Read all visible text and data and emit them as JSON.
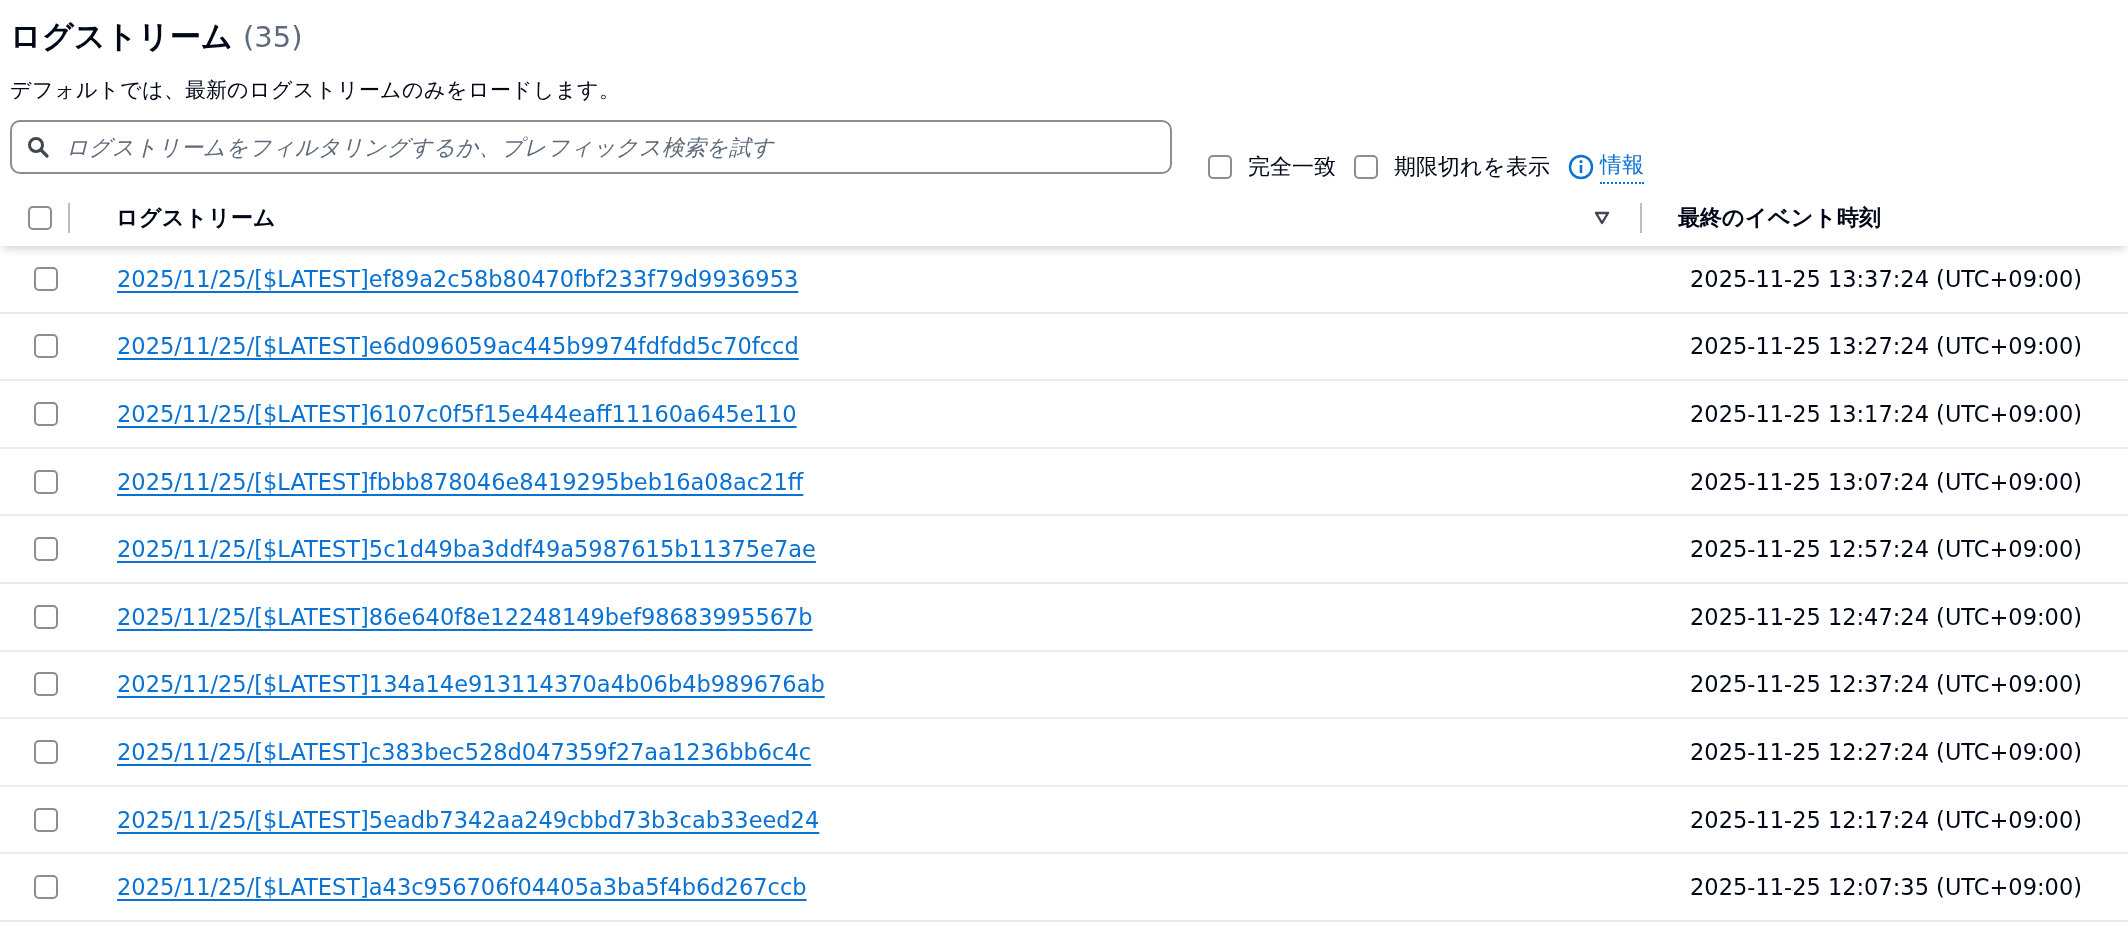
{
  "header": {
    "title": "ログストリーム",
    "count": "(35)",
    "description": "デフォルトでは、最新のログストリームのみをロードします。"
  },
  "search": {
    "placeholder": "ログストリームをフィルタリングするか、プレフィックス検索を試す"
  },
  "options": [
    {
      "label": "完全一致",
      "checked": false
    },
    {
      "label": "期限切れを表示",
      "checked": false
    }
  ],
  "info_link": "情報",
  "table": {
    "select_all_checked": false,
    "columns": [
      {
        "label": "ログストリーム",
        "sortable": true
      },
      {
        "label": "最終のイベント時刻",
        "sortable": false
      }
    ],
    "rows": [
      {
        "checked": false,
        "stream": "2025/11/25/[$LATEST]ef89a2c58b80470fbf233f79d9936953",
        "time": "2025-11-25 13:37:24 (UTC+09:00)"
      },
      {
        "checked": false,
        "stream": "2025/11/25/[$LATEST]e6d096059ac445b9974fdfdd5c70fccd",
        "time": "2025-11-25 13:27:24 (UTC+09:00)"
      },
      {
        "checked": false,
        "stream": "2025/11/25/[$LATEST]6107c0f5f15e444eaff11160a645e110",
        "time": "2025-11-25 13:17:24 (UTC+09:00)"
      },
      {
        "checked": false,
        "stream": "2025/11/25/[$LATEST]fbbb878046e8419295beb16a08ac21ff",
        "time": "2025-11-25 13:07:24 (UTC+09:00)"
      },
      {
        "checked": false,
        "stream": "2025/11/25/[$LATEST]5c1d49ba3ddf49a5987615b11375e7ae",
        "time": "2025-11-25 12:57:24 (UTC+09:00)"
      },
      {
        "checked": false,
        "stream": "2025/11/25/[$LATEST]86e640f8e12248149bef98683995567b",
        "time": "2025-11-25 12:47:24 (UTC+09:00)"
      },
      {
        "checked": false,
        "stream": "2025/11/25/[$LATEST]134a14e913114370a4b06b4b989676ab",
        "time": "2025-11-25 12:37:24 (UTC+09:00)"
      },
      {
        "checked": false,
        "stream": "2025/11/25/[$LATEST]c383bec528d047359f27aa1236bb6c4c",
        "time": "2025-11-25 12:27:24 (UTC+09:00)"
      },
      {
        "checked": false,
        "stream": "2025/11/25/[$LATEST]5eadb7342aa249cbbd73b3cab33eed24",
        "time": "2025-11-25 12:17:24 (UTC+09:00)"
      },
      {
        "checked": false,
        "stream": "2025/11/25/[$LATEST]a43c956706f04405a3ba5f4b6d267ccb",
        "time": "2025-11-25 12:07:35 (UTC+09:00)"
      }
    ]
  }
}
